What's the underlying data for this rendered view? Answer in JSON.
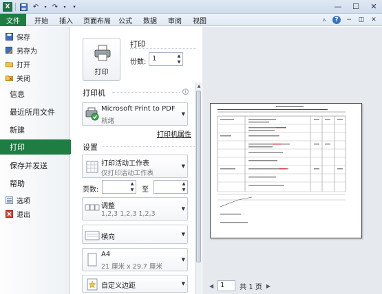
{
  "titlebar": {
    "app_icon": "X"
  },
  "tabs": {
    "file": "文件",
    "items": [
      "开始",
      "插入",
      "页面布局",
      "公式",
      "数据",
      "审阅",
      "视图"
    ]
  },
  "nav": {
    "save": "保存",
    "save_as": "另存为",
    "open": "打开",
    "close": "关闭",
    "info": "信息",
    "recent": "最近所用文件",
    "new": "新建",
    "print": "打印",
    "save_send": "保存并发送",
    "help": "帮助",
    "options": "选项",
    "exit": "退出"
  },
  "print": {
    "section_title": "打印",
    "button_label": "打印",
    "copies_label": "份数:",
    "copies_value": "1"
  },
  "printer": {
    "section_title": "打印机",
    "name": "Microsoft Print to PDF",
    "status": "就绪",
    "properties_link": "打印机属性"
  },
  "settings": {
    "section_title": "设置",
    "scope_main": "打印活动工作表",
    "scope_sub": "仅打印活动工作表",
    "pages_label": "页数:",
    "pages_to": "至",
    "collate_main": "调整",
    "collate_sub": "1,2,3    1,2,3    1,2,3",
    "orientation": "横向",
    "paper_main": "A4",
    "paper_sub": "21 厘米 x 29.7 厘米",
    "margins": "自定义边距"
  },
  "preview": {
    "page_current": "1",
    "page_total": "共 1 页"
  },
  "colors": {
    "accent_green": "#1f7c43",
    "title_bg": "#dfe9f5"
  }
}
